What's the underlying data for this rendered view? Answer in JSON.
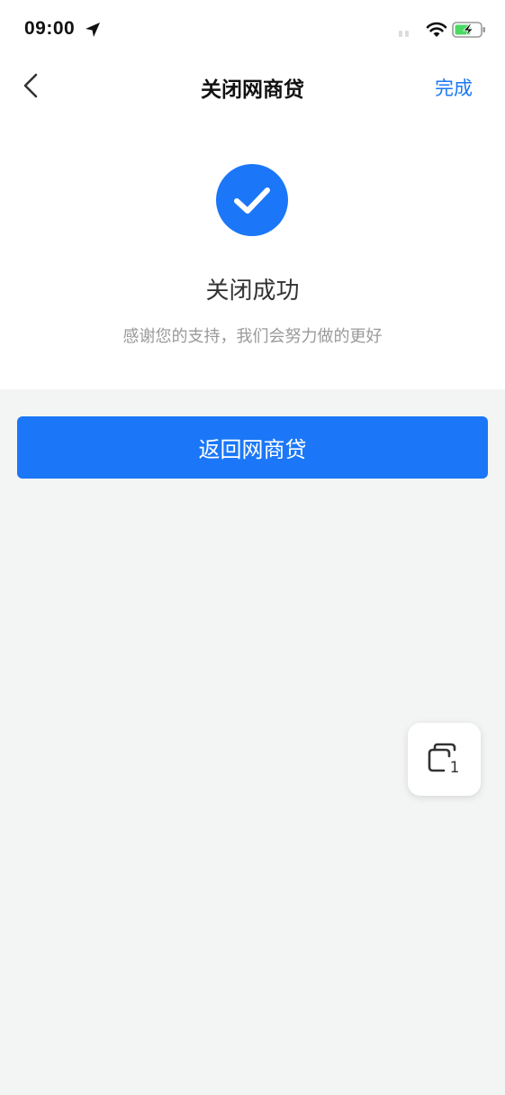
{
  "status_bar": {
    "time": "09:00"
  },
  "nav": {
    "title": "关闭网商贷",
    "done_label": "完成"
  },
  "result": {
    "title": "关闭成功",
    "subtitle": "感谢您的支持，我们会努力做的更好"
  },
  "actions": {
    "return_label": "返回网商贷"
  },
  "floating": {
    "count": "1"
  },
  "colors": {
    "accent": "#1b77f7",
    "background": "#f3f4f4",
    "card": "#ffffff",
    "battery_green": "#4cd964"
  },
  "icons": {
    "status": [
      "location-arrow-icon",
      "signal-icon",
      "wifi-icon",
      "battery-charging-icon"
    ],
    "nav": [
      "back-chevron-icon"
    ],
    "result": [
      "check-circle-icon"
    ],
    "floating": [
      "windows-stack-icon"
    ]
  }
}
